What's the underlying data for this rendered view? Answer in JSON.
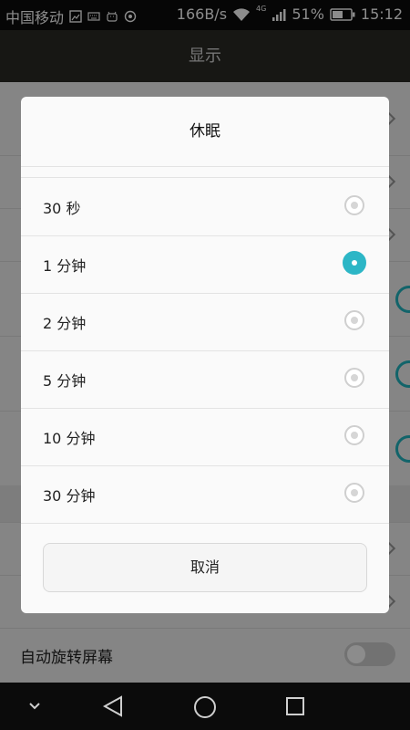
{
  "status_bar": {
    "carrier": "中国移动",
    "speed": "166B/s",
    "network_type": "4G",
    "battery": "51%",
    "time": "15:12"
  },
  "app_bar": {
    "title": "显示"
  },
  "background": {
    "auto_rotate_label": "自动旋转屏幕"
  },
  "dialog": {
    "title": "休眠",
    "options": [
      {
        "label": "30 秒",
        "selected": false
      },
      {
        "label": "1 分钟",
        "selected": true
      },
      {
        "label": "2 分钟",
        "selected": false
      },
      {
        "label": "5 分钟",
        "selected": false
      },
      {
        "label": "10 分钟",
        "selected": false
      },
      {
        "label": "30 分钟",
        "selected": false
      }
    ],
    "cancel_label": "取消"
  },
  "colors": {
    "accent": "#2cb6c6",
    "status_bar_bg": "#0b0b0b",
    "app_bar_bg": "#2a2a26"
  }
}
